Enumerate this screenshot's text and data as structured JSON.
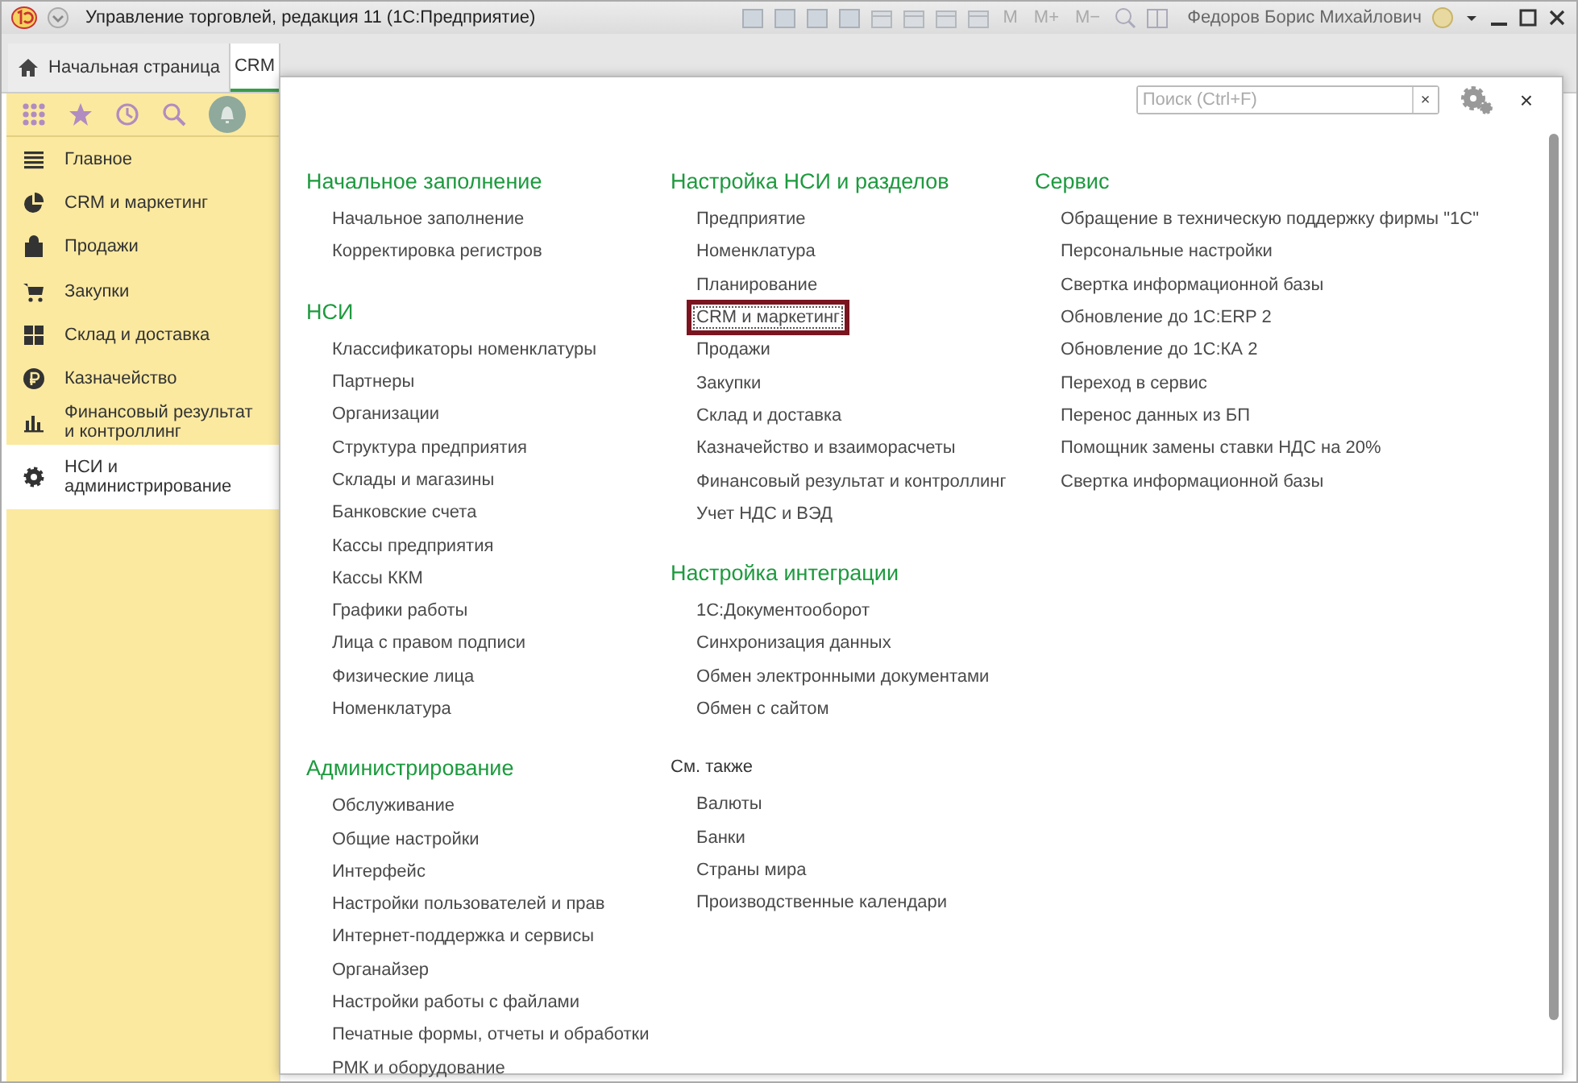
{
  "window": {
    "title": "Управление торговлей, редакция 11 (1С:Предприятие)",
    "memory_buttons": [
      "M",
      "M+",
      "M−"
    ],
    "user": "Федоров Борис Михайлович"
  },
  "tabs": [
    {
      "label": "Начальная страница",
      "kind": "home",
      "selected": false
    },
    {
      "label": "CRM",
      "kind": "plain",
      "selected": true
    }
  ],
  "sidebar": {
    "items": [
      {
        "label": "Главное",
        "selected": false
      },
      {
        "label": "CRM и маркетинг",
        "selected": false
      },
      {
        "label": "Продажи",
        "selected": false
      },
      {
        "label": "Закупки",
        "selected": false
      },
      {
        "label": "Склад и доставка",
        "selected": false
      },
      {
        "label": "Казначейство",
        "selected": false
      },
      {
        "label": "Финансовый результат и контроллинг",
        "selected": false
      },
      {
        "label": "НСИ и администрирование",
        "selected": true
      }
    ]
  },
  "search": {
    "placeholder": "Поиск (Ctrl+F)",
    "clear": "×"
  },
  "close": "×",
  "columns": [
    [
      {
        "kind": "group",
        "title": "Начальное заполнение",
        "links": [
          {
            "text": "Начальное заполнение",
            "highlighted": false
          },
          {
            "text": "Корректировка регистров",
            "highlighted": false
          }
        ]
      },
      {
        "kind": "group",
        "title": "НСИ",
        "links": [
          {
            "text": "Классификаторы номенклатуры",
            "highlighted": false
          },
          {
            "text": "Партнеры",
            "highlighted": false
          },
          {
            "text": "Организации",
            "highlighted": false
          },
          {
            "text": "Структура предприятия",
            "highlighted": false
          },
          {
            "text": "Склады и магазины",
            "highlighted": false
          },
          {
            "text": "Банковские счета",
            "highlighted": false
          },
          {
            "text": "Кассы предприятия",
            "highlighted": false
          },
          {
            "text": "Кассы ККМ",
            "highlighted": false
          },
          {
            "text": "Графики работы",
            "highlighted": false
          },
          {
            "text": "Лица с правом подписи",
            "highlighted": false
          },
          {
            "text": "Физические лица",
            "highlighted": false
          },
          {
            "text": "Номенклатура",
            "highlighted": false
          }
        ]
      },
      {
        "kind": "group",
        "title": "Администрирование",
        "links": [
          {
            "text": "Обслуживание",
            "highlighted": false
          },
          {
            "text": "Общие настройки",
            "highlighted": false
          },
          {
            "text": "Интерфейс",
            "highlighted": false
          },
          {
            "text": "Настройки пользователей и прав",
            "highlighted": false
          },
          {
            "text": "Интернет-поддержка и сервисы",
            "highlighted": false
          },
          {
            "text": "Органайзер",
            "highlighted": false
          },
          {
            "text": "Настройки работы с файлами",
            "highlighted": false
          },
          {
            "text": "Печатные формы, отчеты и обработки",
            "highlighted": false
          },
          {
            "text": "РМК и оборудование",
            "highlighted": false
          }
        ]
      }
    ],
    [
      {
        "kind": "group",
        "title": "Настройка НСИ и разделов",
        "links": [
          {
            "text": "Предприятие",
            "highlighted": false
          },
          {
            "text": "Номенклатура",
            "highlighted": false
          },
          {
            "text": "Планирование",
            "highlighted": false
          },
          {
            "text": "CRM и маркетинг",
            "highlighted": true
          },
          {
            "text": "Продажи",
            "highlighted": false
          },
          {
            "text": "Закупки",
            "highlighted": false
          },
          {
            "text": "Склад и доставка",
            "highlighted": false
          },
          {
            "text": "Казначейство и взаиморасчеты",
            "highlighted": false
          },
          {
            "text": "Финансовый результат и контроллинг",
            "highlighted": false
          },
          {
            "text": "Учет НДС и ВЭД",
            "highlighted": false
          }
        ]
      },
      {
        "kind": "group",
        "title": "Настройка интеграции",
        "links": [
          {
            "text": "1С:Документооборот",
            "highlighted": false
          },
          {
            "text": "Синхронизация данных",
            "highlighted": false
          },
          {
            "text": "Обмен электронными документами",
            "highlighted": false
          },
          {
            "text": "Обмен с сайтом",
            "highlighted": false
          }
        ]
      },
      {
        "kind": "see_also",
        "title": "См. также",
        "links": [
          {
            "text": "Валюты",
            "highlighted": false
          },
          {
            "text": "Банки",
            "highlighted": false
          },
          {
            "text": "Страны мира",
            "highlighted": false
          },
          {
            "text": "Производственные календари",
            "highlighted": false
          }
        ]
      }
    ],
    [
      {
        "kind": "group",
        "title": "Сервис",
        "links": [
          {
            "text": "Обращение в техническую поддержку фирмы \"1С\"",
            "highlighted": false
          },
          {
            "text": "Персональные настройки",
            "highlighted": false
          },
          {
            "text": "Свертка информационной базы",
            "highlighted": false
          },
          {
            "text": "Обновление до 1С:ERP 2",
            "highlighted": false
          },
          {
            "text": "Обновление до 1С:КА 2",
            "highlighted": false
          },
          {
            "text": "Переход в сервис",
            "highlighted": false
          },
          {
            "text": "Перенос данных из БП",
            "highlighted": false
          },
          {
            "text": "Помощник замены ставки НДС на 20%",
            "highlighted": false
          },
          {
            "text": "Свертка информационной базы",
            "highlighted": false
          }
        ]
      }
    ]
  ]
}
